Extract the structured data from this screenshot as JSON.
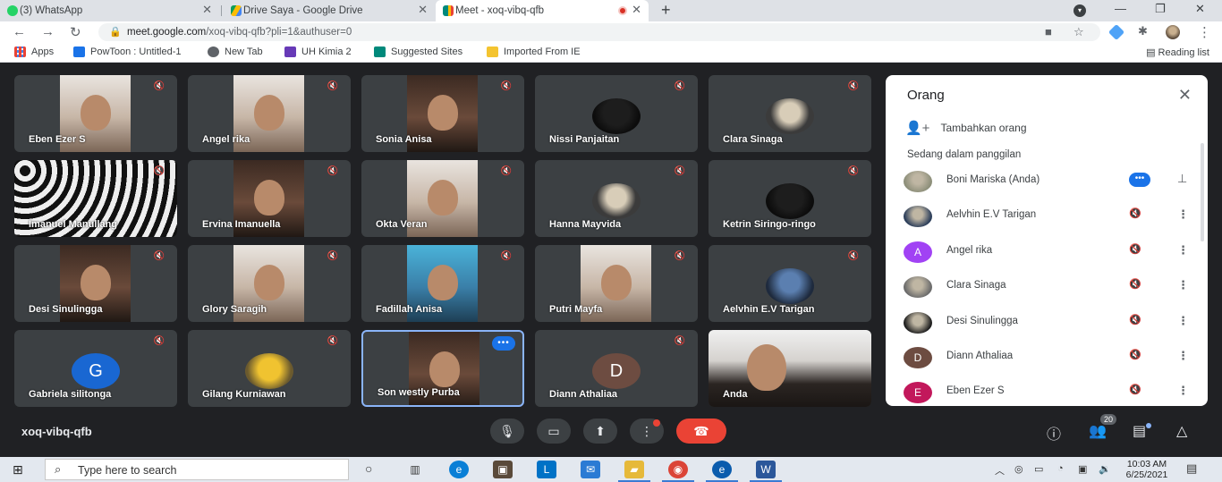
{
  "browser": {
    "tabs": [
      {
        "title": "(3) WhatsApp",
        "favicon": "whatsapp-icon",
        "color": "#25d366"
      },
      {
        "title": "Drive Saya - Google Drive",
        "favicon": "google-drive-icon",
        "color": "#fbbc04"
      },
      {
        "title": "Meet - xoq-vibq-qfb",
        "favicon": "google-meet-icon",
        "color": "#00897b",
        "active": true,
        "recording": true
      }
    ],
    "url_host": "meet.google.com",
    "url_path": "/xoq-vibq-qfb?pli=1&authuser=0",
    "bookmarks": [
      {
        "label": "Apps",
        "icon": "apps-grid-icon",
        "color": "#ea4335"
      },
      {
        "label": "PowToon : Untitled-1",
        "icon": "powtoon-icon",
        "color": "#1a73e8"
      },
      {
        "label": "New Tab",
        "icon": "globe-icon",
        "color": "#5f6368"
      },
      {
        "label": "UH Kimia 2",
        "icon": "uh-icon",
        "color": "#673ab7"
      },
      {
        "label": "Suggested Sites",
        "icon": "bing-icon",
        "color": "#00897b"
      },
      {
        "label": "Imported From IE",
        "icon": "folder-icon",
        "color": "#f4c430"
      }
    ],
    "reading_list": "Reading list"
  },
  "meet": {
    "tiles": [
      {
        "name": "Eben Ezer S",
        "kind": "video",
        "style": "light"
      },
      {
        "name": "Angel rika",
        "kind": "video",
        "style": "light"
      },
      {
        "name": "Sonia Anisa",
        "kind": "video",
        "style": "dark"
      },
      {
        "name": "Nissi Panjaitan",
        "kind": "photo",
        "style": "dark"
      },
      {
        "name": "Clara Sinaga",
        "kind": "photo",
        "style": ""
      },
      {
        "name": "Imanuel Manullang",
        "kind": "video",
        "style": "pattern"
      },
      {
        "name": "Ervina Imanuella",
        "kind": "video",
        "style": "dark"
      },
      {
        "name": "Okta Veran",
        "kind": "video",
        "style": "light"
      },
      {
        "name": "Hanna Mayvida",
        "kind": "photo",
        "style": ""
      },
      {
        "name": "Ketrin Siringo-ringo",
        "kind": "photo",
        "style": "dark"
      },
      {
        "name": "Desi Sinulingga",
        "kind": "video",
        "style": "dark"
      },
      {
        "name": "Glory Saragih",
        "kind": "video",
        "style": "light"
      },
      {
        "name": "Fadillah Anisa",
        "kind": "video",
        "style": "blue"
      },
      {
        "name": "Putri Mayfa",
        "kind": "video",
        "style": "light"
      },
      {
        "name": "Aelvhin E.V Tarigan",
        "kind": "photo",
        "style": "blue"
      },
      {
        "name": "Gabriela silitonga",
        "kind": "letter",
        "letter": "G",
        "color": "#1967d2"
      },
      {
        "name": "Gilang Kurniawan",
        "kind": "photo",
        "style": "yellow"
      },
      {
        "name": "Son westly Purba",
        "kind": "video",
        "style": "dark",
        "speaking": true
      },
      {
        "name": "Diann Athaliaa",
        "kind": "letter",
        "letter": "D",
        "color": "#6d4c41"
      },
      {
        "name": "Anda",
        "kind": "video",
        "style": "anda",
        "self": true
      }
    ],
    "meeting_code": "xoq-vibq-qfb",
    "participant_count": "20",
    "panel": {
      "title": "Orang",
      "add_people": "Tambahkan orang",
      "section": "Sedang dalam panggilan",
      "people": [
        {
          "name": "Boni Mariska (Anda)",
          "avatar": "photo",
          "color": "#8d8f7a",
          "self": true
        },
        {
          "name": "Aelvhin E.V Tarigan",
          "avatar": "photo",
          "color": "#2c3e5a"
        },
        {
          "name": "Angel rika",
          "avatar": "letter",
          "letter": "A",
          "color": "#a142f4"
        },
        {
          "name": "Clara Sinaga",
          "avatar": "photo",
          "color": "#6b6b6b"
        },
        {
          "name": "Desi Sinulingga",
          "avatar": "photo",
          "color": "#1f1f1f"
        },
        {
          "name": "Diann Athaliaa",
          "avatar": "letter",
          "letter": "D",
          "color": "#6d4c41"
        },
        {
          "name": "Eben Ezer S",
          "avatar": "letter",
          "letter": "E",
          "color": "#c2185b"
        }
      ]
    }
  },
  "taskbar": {
    "search_placeholder": "Type here to search",
    "time": "10:03 AM",
    "date": "6/25/2021",
    "apps": [
      {
        "icon": "task-view-icon",
        "color": "#333333"
      },
      {
        "icon": "edge-icon",
        "color": "#0a7fd6"
      },
      {
        "icon": "store-icon",
        "color": "#5a4a3a"
      },
      {
        "icon": "lync-icon",
        "color": "#0072c6"
      },
      {
        "icon": "mail-icon",
        "color": "#2b7bd4"
      },
      {
        "icon": "file-explorer-icon",
        "color": "#e6b93a"
      },
      {
        "icon": "chrome-icon",
        "color": "#db4437"
      },
      {
        "icon": "edge-blue-icon",
        "color": "#0b5cad"
      },
      {
        "icon": "word-icon",
        "color": "#2b579a"
      }
    ]
  }
}
